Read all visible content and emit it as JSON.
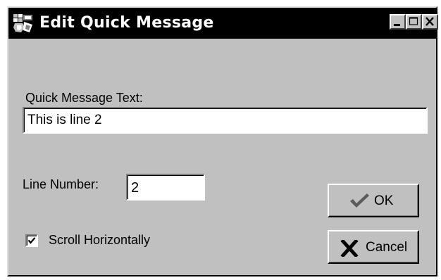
{
  "window": {
    "title": "Edit Quick Message",
    "app_icon": "app-icon",
    "controls": {
      "minimize_icon": "minimize-icon",
      "maximize_icon": "maximize-icon",
      "close_icon": "close-icon"
    }
  },
  "form": {
    "message_label": "Quick Message Text:",
    "message_value": "This is line 2",
    "line_number_label": "Line Number:",
    "line_number_value": "2",
    "scroll_checkbox": {
      "label": "Scroll Horizontally",
      "checked": true
    }
  },
  "buttons": {
    "ok_label": "OK",
    "ok_icon": "checkmark-icon",
    "cancel_label": "Cancel",
    "cancel_icon": "x-icon"
  },
  "colors": {
    "titlebar": "#000000",
    "face": "#c0c0c0",
    "field": "#ffffff",
    "ok_check": "#5a5a5a",
    "cancel_x": "#000000"
  }
}
